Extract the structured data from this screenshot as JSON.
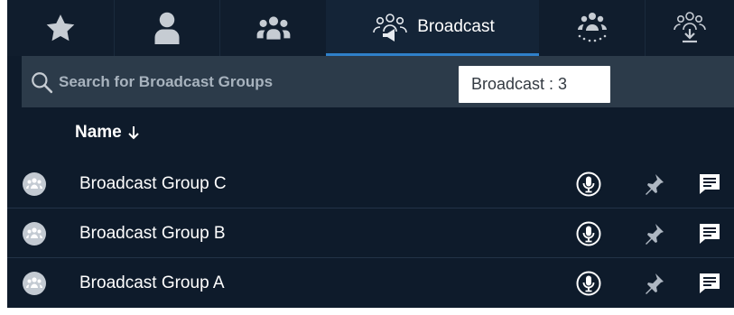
{
  "tabs": [
    {
      "icon": "star-icon",
      "label": ""
    },
    {
      "icon": "person-icon",
      "label": ""
    },
    {
      "icon": "group-icon",
      "label": ""
    },
    {
      "icon": "broadcast-group-icon",
      "label": "Broadcast",
      "active": true
    },
    {
      "icon": "broadcast-attendees-icon",
      "label": ""
    },
    {
      "icon": "broadcast-download-icon",
      "label": ""
    }
  ],
  "search": {
    "placeholder": "Search for Broadcast Groups",
    "value": ""
  },
  "tooltip": {
    "text": "Broadcast : 3"
  },
  "list_header": {
    "name_label": "Name",
    "sort_direction": "descending"
  },
  "groups": [
    {
      "name": "Broadcast Group C"
    },
    {
      "name": "Broadcast Group B"
    },
    {
      "name": "Broadcast Group A"
    }
  ],
  "row_actions": [
    "push-to-talk-icon",
    "rally-point-icon",
    "message-icon"
  ],
  "colors": {
    "background": "#0e1b2b",
    "tab_active": "#142437",
    "accent": "#2f80c9",
    "search_bg": "#2c3b4a",
    "text": "#ffffff",
    "icon_muted": "#aeb7c2"
  }
}
